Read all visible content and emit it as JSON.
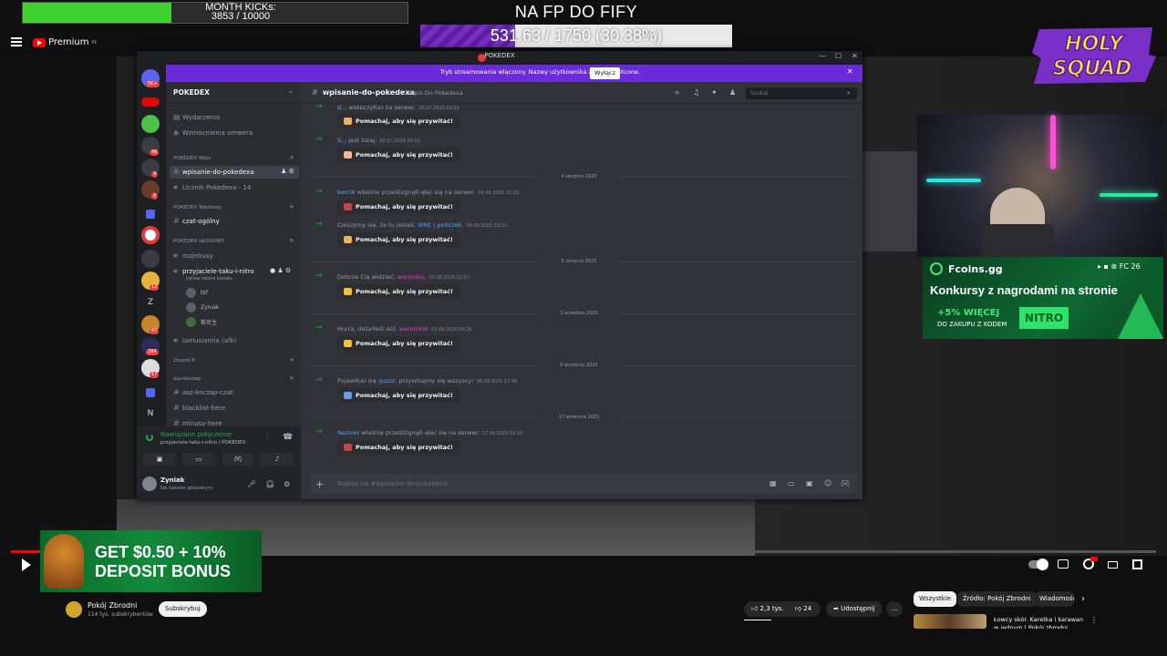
{
  "overlay": {
    "kicks_label": "MONTH KICKs:",
    "kicks_value": "3853 / 10000",
    "kicks_progress": 0.3853,
    "fp_title": "NA FP DO FIFY",
    "fp_value": "531.63 / 1750 (30.38%)",
    "fp_progress": 0.3038,
    "holy_squad_logo": "HOLY SQUAD",
    "fcoins": {
      "name": "Fcoins.gg",
      "platforms": "▸ ▪ ⊗  FC 26",
      "title": "Konkursy z nagrodami na stronie",
      "bonus": "+5% WIĘCEJ",
      "code_text": "DO ZAKUPU Z KODEM",
      "code": "NITRO"
    },
    "deposit": {
      "line1": "GET $0.50 + 10%",
      "line2": "DEPOSIT BONUS"
    }
  },
  "youtube": {
    "logo": "Premium",
    "logo_region": "PL",
    "channel_name": "Pokój Zbrodni",
    "channel_subs": "114 tys. subskrybentów",
    "subscribe": "Subskrybuj",
    "likes": "2,3 tys.",
    "dislikes": "24",
    "share": "Udostępnij",
    "more": "...",
    "chips": [
      "Wszystkie",
      "Źródło: Pokój Zbrodni",
      "Wiadomości"
    ],
    "chip_next": "›",
    "rec_title": "Łowcy skór. Karetka i karawan w jednym | Pokój zbrodni",
    "rec_more": "⋮",
    "progress": 0.024
  },
  "discord": {
    "app_title": "POKEDEX",
    "window_buttons": [
      "—",
      "☐",
      "✕"
    ],
    "stream_banner": "Tryb streamowania włączony. Nazwy użytkownika zostały skrócone.",
    "stream_off": "Wyłącz",
    "stream_close": "✕",
    "server_name": "POKEDEX",
    "server_chevron": "⌄",
    "server_badges": [
      "5K+",
      "46",
      "9",
      "8",
      "12",
      "47",
      "284",
      "17"
    ],
    "channels": {
      "events": "Wydarzenia",
      "boosts": "Wzmocnienia serwera",
      "cat_wpis": "POKEDEX Wpis",
      "ch_wpisanie": "wpisanie-do-pokedexa",
      "ch_licznik": "Licznik Pokedexa - 14",
      "cat_tekstowy": "POKEDEX Tekstowy",
      "ch_czat": "czat-ogólny",
      "cat_glosowy": "POKEDEX GŁOSOWY",
      "ch_rozjebusy": "rozjebusy",
      "ch_przyjaciele": "przyjaciele-taku-i-nitro",
      "ch_status": "Ustaw status kanału",
      "vc_users": [
        "tkf",
        "Zyniak",
        "救世主"
      ],
      "ch_lamusiarnia": "lamusiarnia (afk)",
      "cat_zespol": "Zespół R",
      "cat_asz": "asz-keczap",
      "ch_asz": "asz-keczap-czat",
      "ch_blacklist": "blacklist-here",
      "ch_minusy": "minusy-here",
      "plus": "+"
    },
    "voice": {
      "status": "Nawiązano połączenie",
      "channel": "przyjaciele-taku-i-nitro / POKEDEX"
    },
    "user": {
      "name": "Zyniak",
      "status": "Na kanale głosowym"
    },
    "chat": {
      "channel": "wpisanie-do-pokedexa",
      "topic": "Wpis Do Pokedexa",
      "search_placeholder": "Szukaj",
      "input_placeholder": "Napisz na #wpisanie-do-pokedexa",
      "wave_label": "Pomachaj, aby się przywitać!",
      "dates": [
        "4 sierpnia 2025",
        "5 sierpnia 2025",
        "3 września 2025",
        "6 września 2025",
        "17 września 2025"
      ],
      "messages": [
        {
          "user": "d...",
          "pre": "",
          "post": " wskoczył(a) na serwer.",
          "ts": "30.07.2025 03:01"
        },
        {
          "user": "S...",
          "pre": "",
          "post": " jest tutaj.",
          "ts": "30.07.2025 03:01"
        },
        {
          "user": "bercik",
          "pre": "",
          "post": " właśnie prześlizgnął(-ęła) się na serwer.",
          "ts": "04.08.2025 21:10"
        },
        {
          "user": "9INE | pończek",
          "pre": "Cieszymy się, że tu jesteś, ",
          "post": ".",
          "ts": "04.08.2025 23:10"
        },
        {
          "user": "weronika.",
          "pre": "Dobrze Cię widzieć, ",
          "post": "",
          "ts": "05.08.2025 21:57"
        },
        {
          "user": "weronika",
          "pre": "Hurra, dotarłeś(-aś), ",
          "post": "!",
          "ts": "03.09.2025 04:26"
        },
        {
          "user": "guzzz",
          "pre": "Pojawił(a) się ",
          "post": ". przywitajmy się wszyscy!",
          "ts": "06.09.2025 17:46"
        },
        {
          "user": "Reziner",
          "pre": "",
          "post": " właśnie prześlizgnął(-ęła) się na serwer.",
          "ts": "17.09.2025 03:10"
        }
      ]
    }
  }
}
